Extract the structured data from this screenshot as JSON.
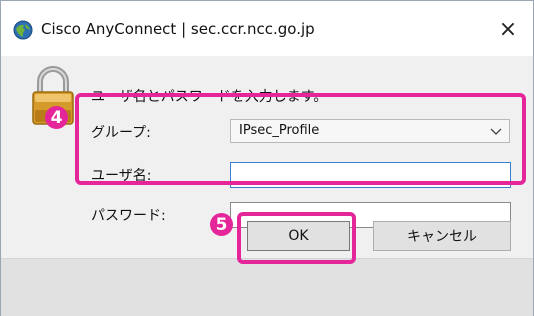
{
  "window": {
    "title": "Cisco AnyConnect | sec.ccr.ncc.go.jp",
    "close_glyph": "×",
    "app_icon": "cisco-globe-icon"
  },
  "dialog": {
    "lock_icon": "padlock-icon",
    "prompt": "ユーザ名とパスワードを入力します。",
    "group_label": "グループ:",
    "group_value": "IPsec_Profile",
    "username_label": "ユーザ名:",
    "username_value": "",
    "password_label": "パスワード:",
    "password_value": ""
  },
  "annotations": {
    "badge_fields": "4",
    "badge_ok": "5",
    "highlight_color": "#e5259a"
  },
  "buttons": {
    "ok": "OK",
    "cancel": "キャンセル"
  }
}
